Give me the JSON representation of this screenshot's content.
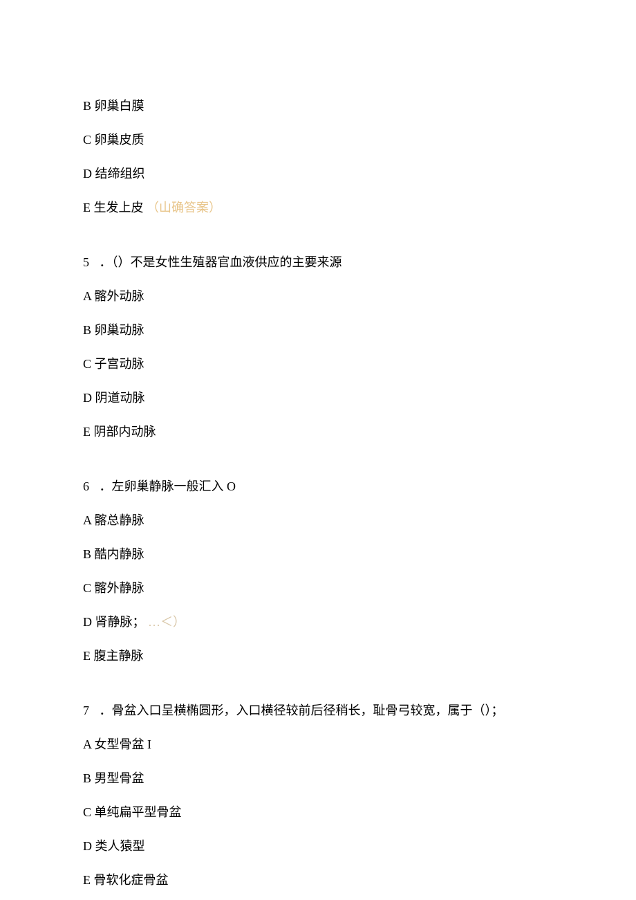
{
  "q4_tail": {
    "options": [
      {
        "label": "B 卵巢白膜",
        "correct": ""
      },
      {
        "label": "C 卵巢皮质",
        "correct": ""
      },
      {
        "label": "D 结缔组织",
        "correct": ""
      },
      {
        "label": "E 生发上皮",
        "correct": "（山确答案）"
      }
    ]
  },
  "q5": {
    "number": "5",
    "stem": "．（）不是女性生殖器官血液供应的主要来源",
    "options": [
      {
        "label": "A 髂外动脉",
        "correct": ""
      },
      {
        "label": "B 卵巢动脉",
        "correct": ""
      },
      {
        "label": "C 子宫动脉",
        "correct": ""
      },
      {
        "label": "D 阴道动脉",
        "correct": ""
      },
      {
        "label": "E 阴部内动脉",
        "correct": ""
      }
    ]
  },
  "q6": {
    "number": "6",
    "stem": "．左卵巢静脉一般汇入 O",
    "options": [
      {
        "label": "A 髂总静脉",
        "correct": ""
      },
      {
        "label": "B 酷内静脉",
        "correct": ""
      },
      {
        "label": "C 髂外静脉",
        "correct": ""
      },
      {
        "label": "D 肾静脉；",
        "correct": "…＜）"
      },
      {
        "label": "E 腹主静脉",
        "correct": ""
      }
    ]
  },
  "q7": {
    "number": "7",
    "stem": "．骨盆入口呈横椭圆形，入口横径较前后径稍长，耻骨弓较宽，属于（）；",
    "options": [
      {
        "label": "A 女型骨盆 I",
        "correct": ""
      },
      {
        "label": "B 男型骨盆",
        "correct": ""
      },
      {
        "label": "C 单纯扁平型骨盆",
        "correct": ""
      },
      {
        "label": "D 类人猿型",
        "correct": ""
      },
      {
        "label": "E 骨软化症骨盆",
        "correct": ""
      }
    ]
  }
}
